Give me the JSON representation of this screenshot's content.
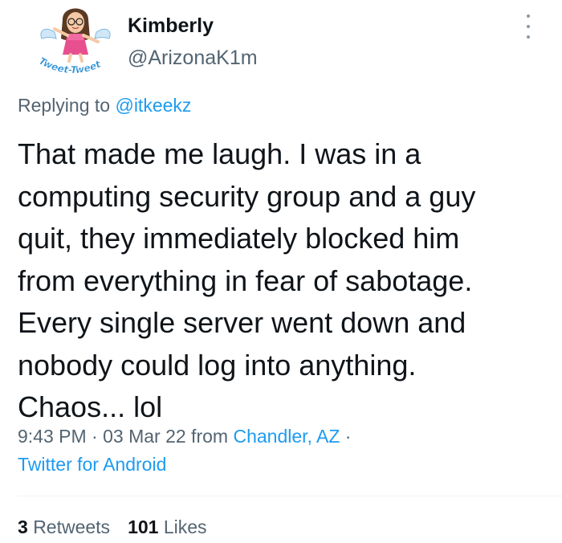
{
  "user": {
    "name": "Kimberly",
    "handle": "@ArizonaK1m",
    "avatar_caption": "Tweet-Tweet"
  },
  "reply": {
    "prefix": "Replying to ",
    "mention": "@itkeekz"
  },
  "tweet": {
    "lines": [
      "That made me laugh. I was in a",
      "computing security group and a guy",
      "quit, they immediately blocked him",
      "from everything in fear of sabotage.",
      "Every single server went down and",
      "nobody could log into anything.",
      "Chaos... lol"
    ]
  },
  "meta": {
    "time": "9:43 PM",
    "sep1": " · ",
    "date": "03 Mar 22",
    "from": " from ",
    "location": "Chandler, AZ",
    "sep2": " ·",
    "source": "Twitter for Android"
  },
  "stats": {
    "retweets_count": "3",
    "retweets_label": "Retweets",
    "likes_count": "101",
    "likes_label": "Likes"
  },
  "colors": {
    "text": "#0f1419",
    "secondary": "#536471",
    "link": "#1d9bf0",
    "divider": "#eff3f4"
  },
  "icons": {
    "more": "more-vertical-icon"
  }
}
